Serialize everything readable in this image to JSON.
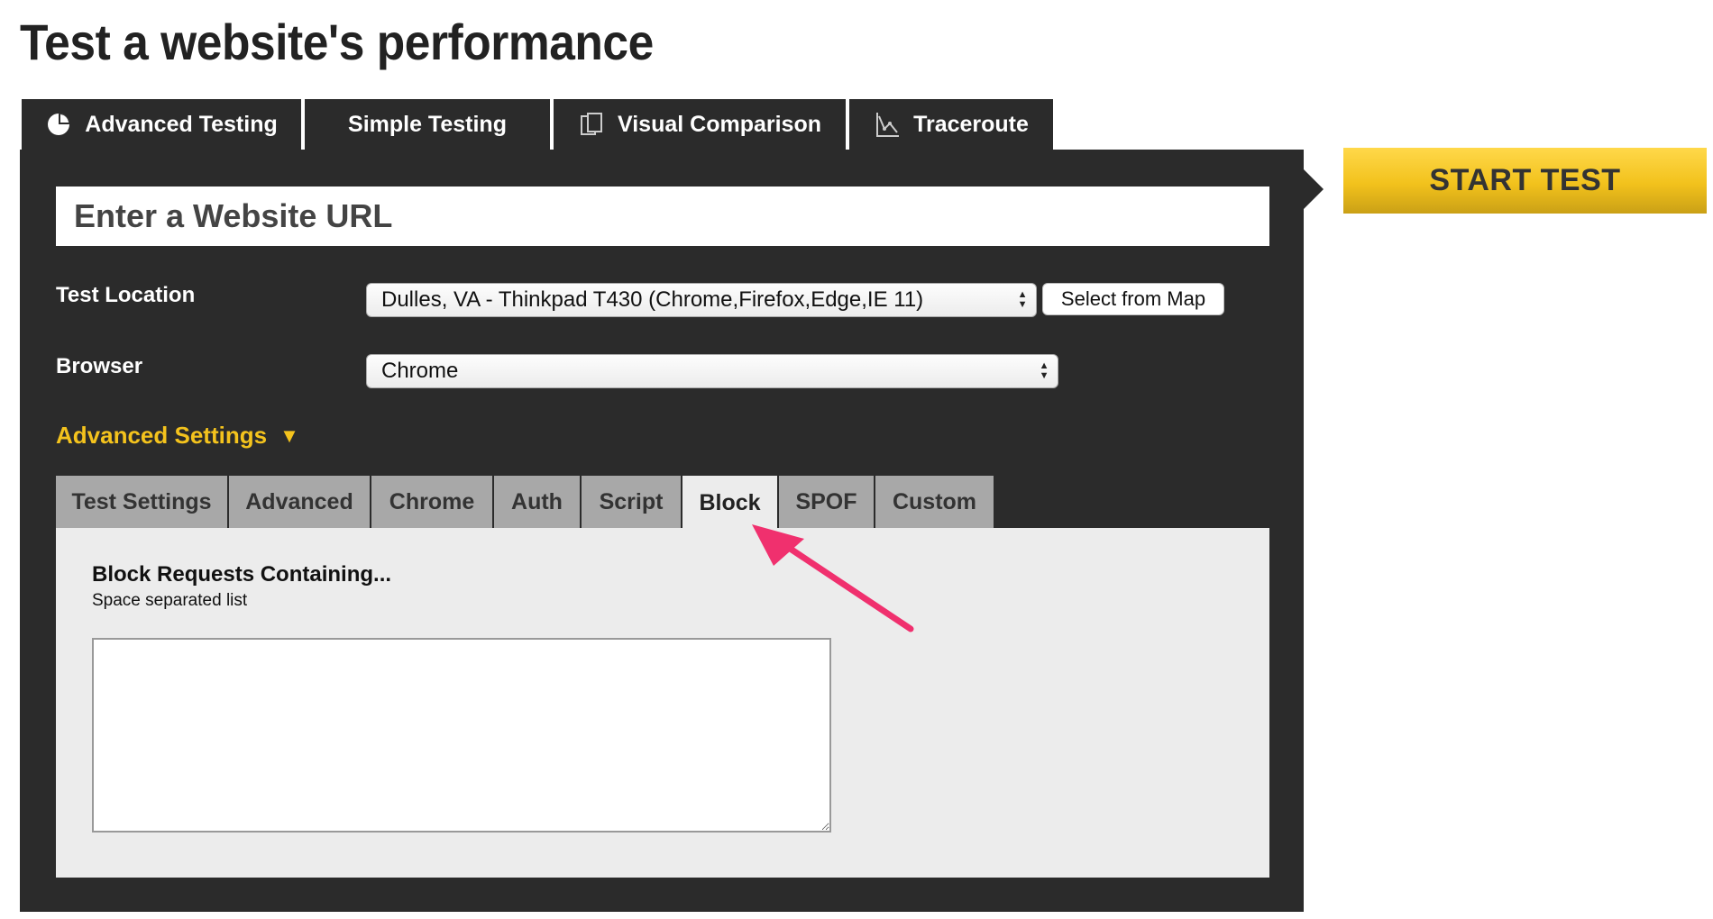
{
  "page_title": "Test a website's performance",
  "top_tabs": [
    {
      "label": "Advanced Testing",
      "icon": "pie-chart-icon",
      "active": true
    },
    {
      "label": "Simple Testing",
      "icon": "",
      "active": false
    },
    {
      "label": "Visual Comparison",
      "icon": "document-compare-icon",
      "active": false
    },
    {
      "label": "Traceroute",
      "icon": "traceroute-graph-icon",
      "active": false
    }
  ],
  "start_test_label": "START TEST",
  "url": {
    "placeholder": "Enter a Website URL",
    "value": ""
  },
  "test_location": {
    "label": "Test Location",
    "selected": "Dulles, VA - Thinkpad T430 (Chrome,Firefox,Edge,IE 11)",
    "map_button": "Select from Map"
  },
  "browser": {
    "label": "Browser",
    "selected": "Chrome"
  },
  "advanced_settings": {
    "label": "Advanced Settings",
    "expanded": true
  },
  "sub_tabs": [
    {
      "label": "Test Settings",
      "active": false
    },
    {
      "label": "Advanced",
      "active": false
    },
    {
      "label": "Chrome",
      "active": false
    },
    {
      "label": "Auth",
      "active": false
    },
    {
      "label": "Script",
      "active": false
    },
    {
      "label": "Block",
      "active": true
    },
    {
      "label": "SPOF",
      "active": false
    },
    {
      "label": "Custom",
      "active": false
    }
  ],
  "block_panel": {
    "heading": "Block Requests Containing...",
    "hint": "Space separated list",
    "value": ""
  },
  "colors": {
    "panel": "#2b2b2b",
    "accent_yellow": "#f4c31d",
    "annotation_arrow": "#f0306e"
  }
}
